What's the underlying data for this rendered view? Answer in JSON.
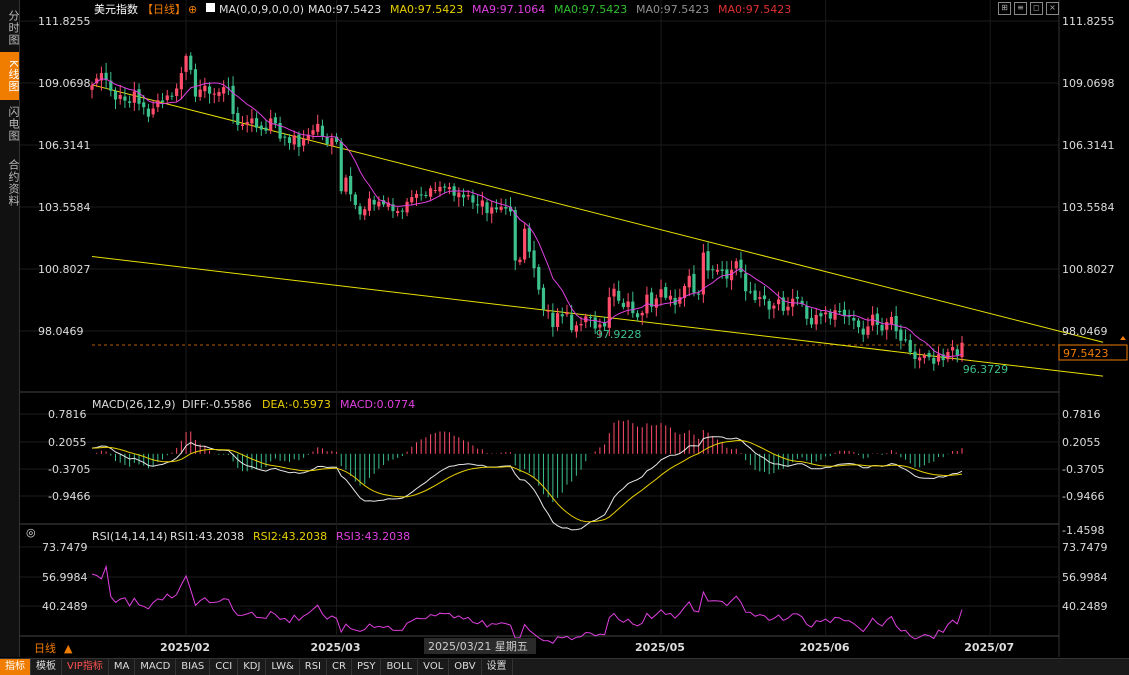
{
  "header": {
    "name": "美元指数",
    "period_tag": "【日线】",
    "ma_params": "MA(0,0,9,0,0,0)",
    "ma_items": [
      {
        "label": "MA0:97.5423",
        "color": "#e0e0e0"
      },
      {
        "label": "MA0:97.5423",
        "color": "#e8d000"
      },
      {
        "label": "MA9:97.1064",
        "color": "#e040e0"
      },
      {
        "label": "MA0:97.5423",
        "color": "#30c030"
      },
      {
        "label": "MA0:97.5423",
        "color": "#909090"
      },
      {
        "label": "MA0:97.5423",
        "color": "#e03030"
      }
    ]
  },
  "left_tabs": [
    "分时图",
    "K线图",
    "闪电图",
    "合约资料"
  ],
  "bottom_tabs": [
    "指标",
    "模板",
    "VIP指标",
    "MA",
    "MACD",
    "BIAS",
    "CCI",
    "KDJ",
    "LW&",
    "RSI",
    "CR",
    "PSY",
    "BOLL",
    "VOL",
    "OBV",
    "设置"
  ],
  "period_label": "日线",
  "macd": {
    "title": "MACD(26,12,9)",
    "diff": "DIFF:-0.5586",
    "dea": "DEA:-0.5973",
    "macd": "MACD:0.0774"
  },
  "rsi": {
    "title": "RSI(14,14,14)",
    "rsi1": "RSI1:43.2038",
    "rsi2": "RSI2:43.2038",
    "rsi3": "RSI3:43.2038"
  },
  "crosshair_date": "2025/03/21 星期五",
  "colors": {
    "up": "#ff4d6a",
    "down": "#3cc08c",
    "ma9": "#e040e0",
    "trend": "#e8e000"
  },
  "chart_data": [
    {
      "type": "candlestick",
      "ylim": [
        96.3729,
        111.8255
      ],
      "y_ticks": [
        "111.8255",
        "109.0698",
        "106.3141",
        "103.5584",
        "100.8027",
        "98.0469"
      ],
      "x_ticks": [
        "2025/02",
        "2025/03",
        "2025/05",
        "2025/06",
        "2025/07"
      ],
      "x_tick_index": [
        20,
        52,
        121,
        156,
        191
      ],
      "last_price": "97.5423",
      "annotations": [
        {
          "text": "97.9228",
          "index": 108,
          "value": 97.9228
        },
        {
          "text": "96.3729",
          "index": 186,
          "value": 96.3729
        }
      ],
      "trendlines": [
        {
          "from": [
            0,
            109.0
          ],
          "to": [
            215,
            97.6
          ]
        },
        {
          "from": [
            0,
            101.4
          ],
          "to": [
            215,
            96.1
          ]
        }
      ],
      "series": [
        {
          "name": "close",
          "values": [
            108.98,
            109.28,
            109.52,
            109.21,
            108.74,
            108.35,
            108.55,
            108.3,
            108.2,
            108.71,
            108.16,
            108.01,
            107.59,
            107.95,
            108.32,
            108.24,
            108.53,
            108.48,
            108.84,
            109.52,
            110.28,
            109.66,
            108.48,
            108.79,
            108.96,
            108.61,
            108.61,
            108.68,
            108.9,
            108.86,
            107.71,
            107.22,
            107.25,
            107.35,
            107.51,
            107.1,
            107.02,
            106.97,
            107.51,
            107.29,
            106.62,
            106.69,
            106.42,
            106.76,
            106.25,
            106.61,
            106.79,
            106.99,
            107.27,
            106.71,
            106.38,
            106.64,
            106.47,
            104.29,
            104.89,
            104.15,
            103.68,
            103.26,
            103.49,
            103.97,
            103.7,
            103.83,
            103.7,
            103.79,
            103.41,
            103.41,
            103.4,
            103.82,
            104.03,
            104.17,
            104.12,
            104.11,
            104.42,
            104.34,
            104.48,
            104.45,
            104.47,
            104.09,
            104.23,
            104.01,
            104.12,
            103.79,
            103.66,
            103.88,
            103.32,
            103.57,
            103.49,
            103.6,
            103.52,
            103.39,
            101.22,
            101.26,
            102.63,
            101.61,
            100.88,
            99.93,
            99.06,
            99.0,
            98.28,
            98.89,
            98.75,
            98.91,
            98.14,
            98.35,
            98.41,
            98.75,
            98.69,
            98.21,
            98.39,
            98.3,
            99.6,
            99.97,
            99.44,
            99.16,
            99.41,
            98.89,
            98.71,
            98.9,
            99.71,
            99.18,
            99.54,
            99.95,
            99.57,
            99.66,
            99.26,
            99.6,
            100.09,
            100.54,
            99.8,
            99.73,
            101.57,
            100.78,
            100.82,
            100.81,
            100.76,
            100.42,
            100.81,
            101.19,
            100.71,
            99.86,
            99.84,
            99.47,
            99.6,
            99.51,
            99.05,
            99.22,
            99.5,
            98.99,
            99.18,
            99.53,
            99.53,
            99.29,
            98.64,
            98.39,
            98.81,
            98.75,
            98.92,
            98.65,
            99.02,
            98.96,
            98.76,
            98.76,
            98.56,
            98.27,
            97.94,
            98.3,
            98.82,
            98.37,
            98.12,
            98.5,
            98.72,
            98.09,
            97.67,
            97.7,
            97.16,
            96.86,
            96.93,
            97.03,
            96.94,
            96.65,
            97.07,
            96.81,
            97.17,
            97.39,
            97.03,
            97.58
          ]
        }
      ]
    },
    {
      "type": "bar+line",
      "name": "MACD",
      "ylim": [
        -1.4598,
        0.7816
      ],
      "y_ticks": [
        "0.7816",
        "0.2055",
        "-0.3705",
        "-0.9466",
        "-1.4598"
      ],
      "series": [
        {
          "name": "DIFF",
          "values": [
            0.109,
            0.121,
            0.149,
            0.146,
            0.103,
            0.034,
            -0.003,
            -0.053,
            -0.1,
            -0.086,
            -0.125,
            -0.164,
            -0.224,
            -0.237,
            -0.216,
            -0.204,
            -0.167,
            -0.139,
            -0.08,
            0.019,
            0.156,
            0.215,
            0.167,
            0.148,
            0.144,
            0.112,
            0.085,
            0.071,
            0.07,
            0.063,
            -0.017,
            -0.114,
            -0.186,
            -0.23,
            -0.248,
            -0.284,
            -0.312,
            -0.331,
            -0.294,
            -0.279,
            -0.317,
            -0.337,
            -0.364,
            -0.352,
            -0.376,
            -0.362,
            -0.336,
            -0.298,
            -0.243,
            -0.241,
            -0.262,
            -0.254,
            -0.257,
            -0.423,
            -0.495,
            -0.609,
            -0.728,
            -0.844,
            -0.904,
            -0.901,
            -0.909,
            -0.895,
            -0.887,
            -0.862,
            -0.865,
            -0.86,
            -0.848,
            -0.8,
            -0.737,
            -0.667,
            -0.603,
            -0.545,
            -0.468,
            -0.406,
            -0.34,
            -0.287,
            -0.242,
            -0.232,
            -0.207,
            -0.203,
            -0.19,
            -0.204,
            -0.223,
            -0.218,
            -0.251,
            -0.253,
            -0.254,
            -0.242,
            -0.234,
            -0.232,
            -0.388,
            -0.494,
            -0.503,
            -0.584,
            -0.692,
            -0.842,
            -1.02,
            -1.152,
            -1.313,
            -1.38,
            -1.422,
            -1.419,
            -1.457,
            -1.453,
            -1.434,
            -1.37,
            -1.302,
            -1.273,
            -1.219,
            -1.169,
            -1.011,
            -0.836,
            -0.733,
            -0.663,
            -0.57,
            -0.529,
            -0.495,
            -0.439,
            -0.328,
            -0.28,
            -0.21,
            -0.116,
            -0.07,
            -0.027,
            -0.024,
            0.006,
            0.068,
            0.151,
            0.154,
            0.15,
            0.291,
            0.317,
            0.327,
            0.327,
            0.322,
            0.288,
            0.286,
            0.302,
            0.263,
            0.177,
            0.105,
            0.018,
            -0.038,
            -0.087,
            -0.158,
            -0.193,
            -0.196,
            -0.224,
            -0.238,
            -0.214,
            -0.192,
            -0.19,
            -0.236,
            -0.287,
            -0.286,
            -0.286,
            -0.26,
            -0.259,
            -0.225,
            -0.199,
            -0.193,
            -0.186,
            -0.195,
            -0.223,
            -0.268,
            -0.268,
            -0.227,
            -0.226,
            -0.242,
            -0.222,
            -0.186,
            -0.205,
            -0.261,
            -0.298,
            -0.358,
            -0.426,
            -0.46,
            -0.469,
            -0.467,
            -0.473,
            -0.437,
            -0.446,
            -0.42,
            -0.381,
            -0.376,
            -0.334
          ]
        },
        {
          "name": "DEA",
          "values": [
            0.109,
            0.111,
            0.119,
            0.124,
            0.12,
            0.103,
            0.082,
            0.055,
            0.024,
            0.002,
            -0.023,
            -0.051,
            -0.086,
            -0.116,
            -0.136,
            -0.15,
            -0.153,
            -0.15,
            -0.136,
            -0.105,
            -0.053,
            0.001,
            0.034,
            0.057,
            0.074,
            0.082,
            0.082,
            0.08,
            0.078,
            0.075,
            0.056,
            0.022,
            -0.02,
            -0.062,
            -0.099,
            -0.136,
            -0.171,
            -0.203,
            -0.221,
            -0.233,
            -0.25,
            -0.267,
            -0.287,
            -0.3,
            -0.315,
            -0.324,
            -0.326,
            -0.32,
            -0.305,
            -0.292,
            -0.286,
            -0.28,
            -0.275,
            -0.305,
            -0.343,
            -0.396,
            -0.462,
            -0.539,
            -0.612,
            -0.67,
            -0.718,
            -0.753,
            -0.78,
            -0.796,
            -0.81,
            -0.82,
            -0.826,
            -0.821,
            -0.804,
            -0.777,
            -0.742,
            -0.703,
            -0.656,
            -0.606,
            -0.553,
            -0.5,
            -0.448,
            -0.405,
            -0.365,
            -0.332,
            -0.304,
            -0.284,
            -0.272,
            -0.261,
            -0.259,
            -0.258,
            -0.257,
            -0.254,
            -0.25,
            -0.246,
            -0.275,
            -0.318,
            -0.355,
            -0.401,
            -0.459,
            -0.536,
            -0.633,
            -0.736,
            -0.851,
            -0.957,
            -1.05,
            -1.124,
            -1.191,
            -1.243,
            -1.281,
            -1.299,
            -1.3,
            -1.295,
            -1.28,
            -1.258,
            -1.208,
            -1.134,
            -1.054,
            -0.976,
            -0.895,
            -0.822,
            -0.756,
            -0.693,
            -0.62,
            -0.552,
            -0.484,
            -0.41,
            -0.342,
            -0.279,
            -0.228,
            -0.181,
            -0.131,
            -0.075,
            -0.03,
            0.006,
            0.063,
            0.114,
            0.156,
            0.19,
            0.216,
            0.23,
            0.241,
            0.253,
            0.255,
            0.239,
            0.212,
            0.173,
            0.131,
            0.087,
            0.038,
            -0.008,
            -0.045,
            -0.081,
            -0.113,
            -0.133,
            -0.145,
            -0.154,
            -0.171,
            -0.194,
            -0.213,
            -0.228,
            -0.234,
            -0.239,
            -0.236,
            -0.228,
            -0.221,
            -0.214,
            -0.21,
            -0.212,
            -0.223,
            -0.232,
            -0.231,
            -0.23,
            -0.232,
            -0.23,
            -0.221,
            -0.218,
            -0.227,
            -0.241,
            -0.265,
            -0.297,
            -0.33,
            -0.358,
            -0.38,
            -0.398,
            -0.406,
            -0.414,
            -0.415,
            -0.408,
            -0.402,
            -0.388
          ]
        }
      ]
    },
    {
      "type": "line",
      "name": "RSI",
      "ylim": [
        29.0,
        77.5
      ],
      "y_ticks": [
        "73.7479",
        "56.9984",
        "40.2489"
      ],
      "series": [
        {
          "name": "RSI1",
          "values": [
            62.4,
            61.6,
            59.8,
            66.4,
            50.3,
            47.1,
            48.9,
            49.6,
            45.2,
            49.3,
            45.8,
            45.0,
            43.6,
            47.0,
            49.0,
            48.4,
            51.6,
            49.5,
            51.3,
            56.7,
            61.4,
            53.7,
            45.5,
            48.1,
            49.6,
            47.0,
            47.1,
            47.5,
            49.1,
            48.7,
            43.2,
            40.1,
            40.2,
            40.9,
            41.8,
            39.0,
            38.8,
            38.5,
            42.2,
            40.6,
            38.0,
            38.5,
            36.2,
            40.2,
            37.4,
            39.8,
            41.2,
            43.4,
            45.6,
            40.9,
            38.1,
            39.8,
            38.5,
            31.1,
            35.4,
            33.0,
            32.2,
            31.5,
            32.5,
            35.4,
            33.6,
            34.2,
            33.6,
            34.3,
            32.1,
            32.0,
            32.1,
            36.0,
            37.2,
            38.6,
            38.3,
            38.4,
            40.6,
            39.8,
            41.3,
            41.0,
            41.2,
            38.7,
            39.9,
            38.1,
            39.0,
            36.4,
            35.6,
            37.3,
            33.8,
            35.7,
            35.3,
            36.1,
            35.7,
            34.8,
            27.9,
            28.1,
            35.2,
            32.0,
            30.1,
            28.0,
            26.5,
            26.4,
            25.1,
            28.5,
            28.0,
            28.8,
            27.0,
            28.3,
            28.7,
            30.9,
            30.6,
            29.1,
            30.0,
            29.7,
            38.9,
            41.1,
            37.9,
            36.4,
            38.1,
            35.4,
            34.5,
            35.9,
            41.2,
            38.5,
            40.6,
            43.1,
            40.6,
            41.2,
            38.6,
            41.2,
            44.5,
            47.4,
            42.5,
            42.0,
            52.7,
            47.8,
            48.0,
            47.9,
            47.6,
            45.4,
            48.1,
            50.5,
            47.1,
            41.8,
            41.7,
            39.6,
            40.5,
            39.9,
            37.4,
            38.5,
            40.3,
            37.4,
            38.6,
            40.9,
            40.9,
            39.3,
            35.2,
            33.8,
            37.2,
            36.8,
            38.1,
            36.2,
            39.1,
            38.7,
            37.2,
            37.2,
            35.7,
            33.6,
            31.4,
            34.6,
            38.6,
            35.9,
            34.4,
            37.6,
            39.5,
            34.5,
            31.7,
            32.0,
            29.0,
            27.4,
            28.4,
            29.8,
            29.2,
            27.6,
            32.2,
            31.0,
            35.2,
            37.5,
            35.5,
            43.2
          ]
        }
      ]
    }
  ]
}
